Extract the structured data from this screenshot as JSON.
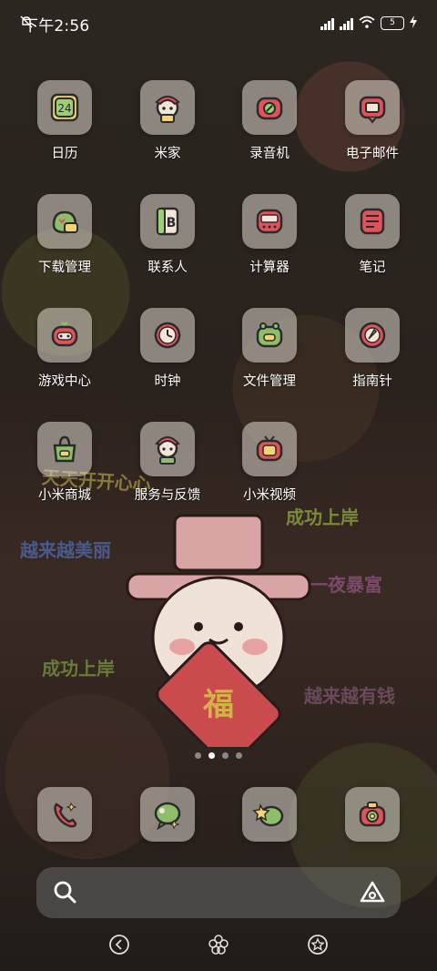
{
  "status": {
    "time": "下午2:56",
    "battery_level": "5"
  },
  "apps": [
    {
      "label": "日历",
      "icon": "calendar-icon"
    },
    {
      "label": "米家",
      "icon": "mijia-icon"
    },
    {
      "label": "录音机",
      "icon": "recorder-icon"
    },
    {
      "label": "电子邮件",
      "icon": "email-icon"
    },
    {
      "label": "下载管理",
      "icon": "download-icon"
    },
    {
      "label": "联系人",
      "icon": "contacts-icon"
    },
    {
      "label": "计算器",
      "icon": "calculator-icon"
    },
    {
      "label": "笔记",
      "icon": "notes-icon"
    },
    {
      "label": "游戏中心",
      "icon": "game-center-icon"
    },
    {
      "label": "时钟",
      "icon": "clock-icon"
    },
    {
      "label": "文件管理",
      "icon": "file-manager-icon"
    },
    {
      "label": "指南针",
      "icon": "compass-icon"
    },
    {
      "label": "小米商城",
      "icon": "mi-store-icon"
    },
    {
      "label": "服务与反馈",
      "icon": "service-feedback-icon"
    },
    {
      "label": "小米视频",
      "icon": "mi-video-icon"
    }
  ],
  "calendar_day": "24",
  "wallpaper_text": [
    "天天开开心心",
    "成功上岸",
    "越来越美丽",
    "一夜暴富",
    "成功上岸",
    "越来越有钱"
  ],
  "page_indicator": {
    "count": 4,
    "active": 1
  },
  "dock": [
    {
      "icon": "phone-icon"
    },
    {
      "icon": "messages-icon"
    },
    {
      "icon": "browser-icon"
    },
    {
      "icon": "camera-icon"
    }
  ],
  "colors": {
    "tile": "#dcd7cd",
    "accent_red": "#e2525a",
    "accent_green": "#8dbf6a",
    "accent_yellow": "#f3d27a"
  }
}
